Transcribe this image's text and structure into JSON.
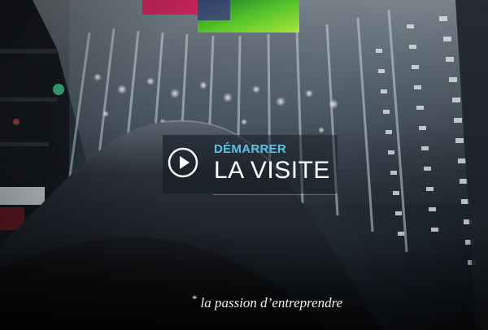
{
  "hero": {
    "cta_kicker": "DÉMARRER",
    "cta_title": "LA VISITE",
    "tagline_mark": "*",
    "tagline": "la passion d’entreprendre"
  },
  "icons": {
    "cta": "play-circle-icon"
  },
  "colors": {
    "accent": "#5cc4e6",
    "title": "#ffffff",
    "tagline": "#f2f2f2",
    "panel": "rgba(20,26,34,0.6)"
  }
}
